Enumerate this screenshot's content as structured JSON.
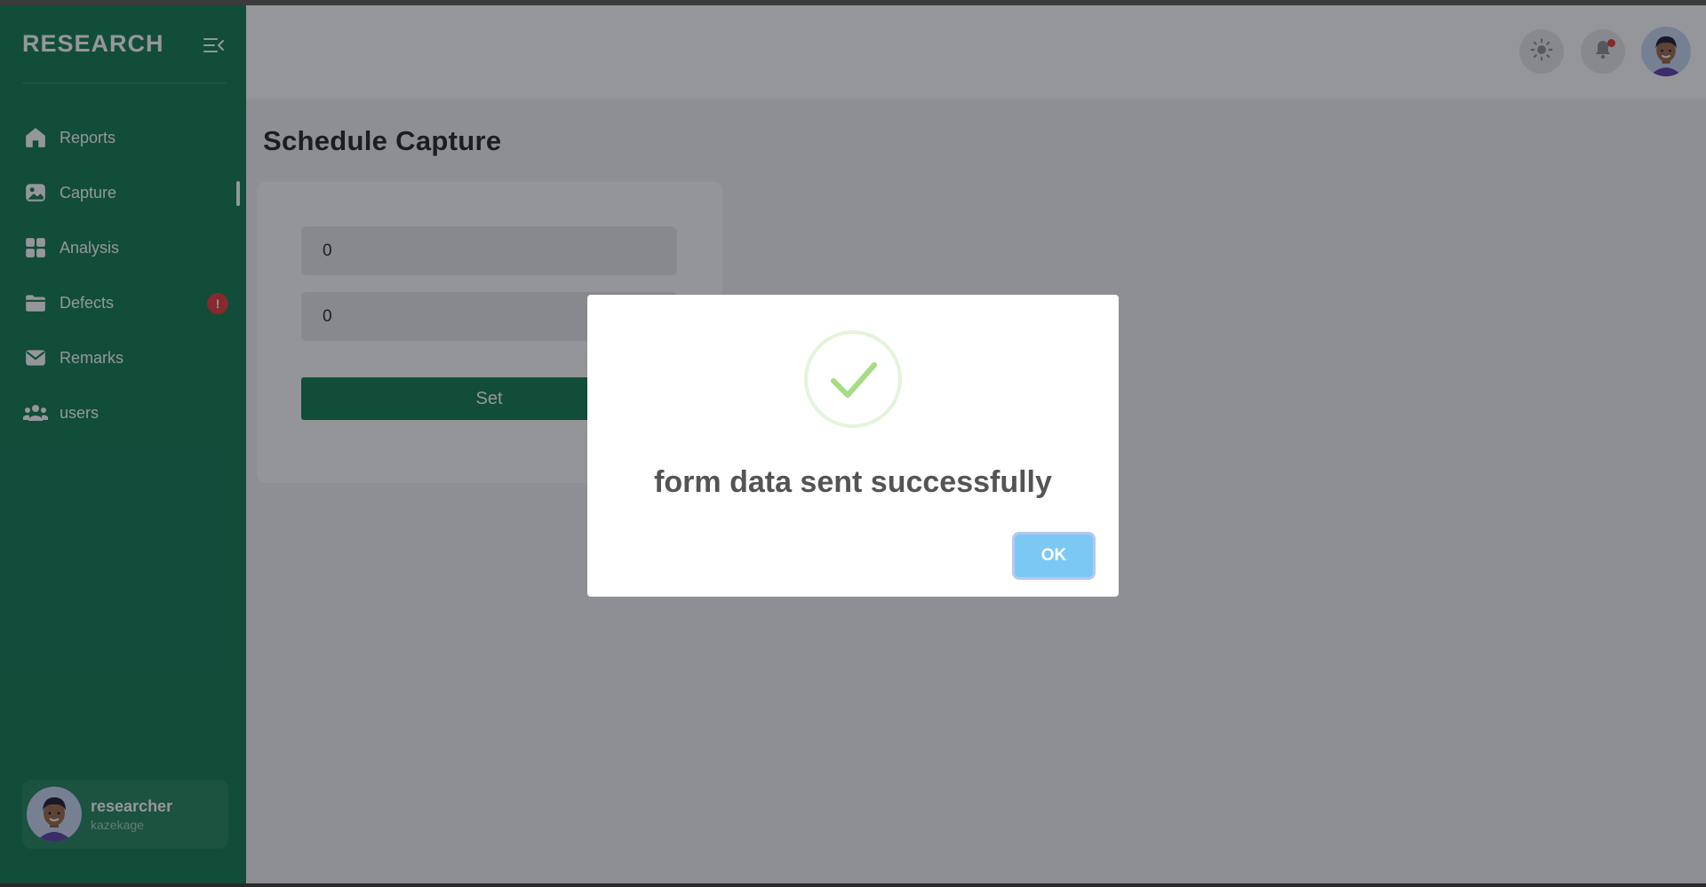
{
  "app": {
    "brand": "RESEARCH"
  },
  "sidebar": {
    "items": [
      {
        "label": "Reports",
        "icon": "home-icon"
      },
      {
        "label": "Capture",
        "icon": "image-icon",
        "active": true
      },
      {
        "label": "Analysis",
        "icon": "grid-icon"
      },
      {
        "label": "Defects",
        "icon": "folder-icon",
        "badge": "!"
      },
      {
        "label": "Remarks",
        "icon": "mail-icon"
      },
      {
        "label": "users",
        "icon": "users-icon"
      }
    ],
    "user": {
      "name": "researcher",
      "sub": "kazekage"
    }
  },
  "header": {
    "icons": [
      "sun-icon",
      "bell-icon",
      "avatar"
    ],
    "notification_dot_color": "#e23b3b"
  },
  "page": {
    "title": "Schedule Capture",
    "form": {
      "field1_value": "0",
      "field2_value": "0",
      "submit_label": "Set"
    }
  },
  "modal": {
    "message": "form data sent successfully",
    "ok_label": "OK"
  },
  "colors": {
    "sidebar": "#0f7a4f",
    "accent": "#0f7a4f",
    "success": "#a5dc86",
    "ok_button": "#7cc8f5",
    "badge": "#e23b3b"
  }
}
